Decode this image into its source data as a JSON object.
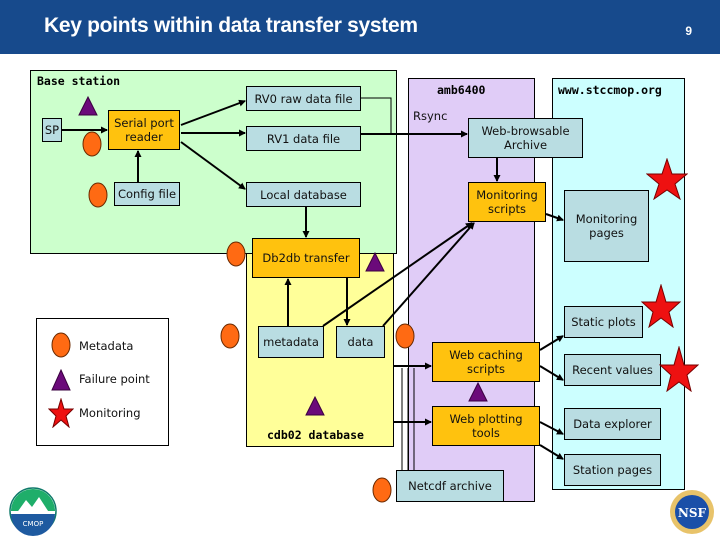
{
  "header": {
    "title": "Key points within data transfer system",
    "page_number": "9"
  },
  "regions": {
    "base_station": "Base station",
    "amb6400": "amb6400",
    "stccmop": "www.stccmop.org",
    "cdb02": "cdb02 database"
  },
  "boxes": {
    "sp": "SP",
    "serial_port_reader": "Serial port reader",
    "config_file": "Config file",
    "rv0": "RV0 raw data file",
    "rv1": "RV1 data file",
    "local_db": "Local database",
    "db2db": "Db2db transfer",
    "metadata": "metadata",
    "data": "data",
    "web_archive": "Web-browsable Archive",
    "monitoring_scripts": "Monitoring scripts",
    "monitoring_pages": "Monitoring pages",
    "web_caching": "Web caching scripts",
    "web_plotting": "Web plotting tools",
    "netcdf": "Netcdf archive",
    "static_plots": "Static plots",
    "recent_values": "Recent values",
    "data_explorer": "Data explorer",
    "station_pages": "Station pages"
  },
  "labels": {
    "rsync": "Rsync"
  },
  "legend": {
    "items": [
      {
        "label": "Metadata",
        "symbol": "orange-ellipse"
      },
      {
        "label": "Failure point",
        "symbol": "purple-triangle"
      },
      {
        "label": "Monitoring",
        "symbol": "red-star"
      }
    ]
  },
  "logos": {
    "left": "CMOP",
    "right": "NSF"
  },
  "colors": {
    "header": "#174a8c",
    "base_station_bg": "#ccffcc",
    "amb6400_bg": "#e0ccf7",
    "stccmop_bg": "#ccffff",
    "cdb02_bg": "#ffff99",
    "box_blue": "#b9dde2",
    "box_orange": "#ffc20e",
    "metadata_marker": "#ff6a13",
    "failure_marker": "#6b0a7a",
    "monitoring_marker": "#ee1111"
  }
}
